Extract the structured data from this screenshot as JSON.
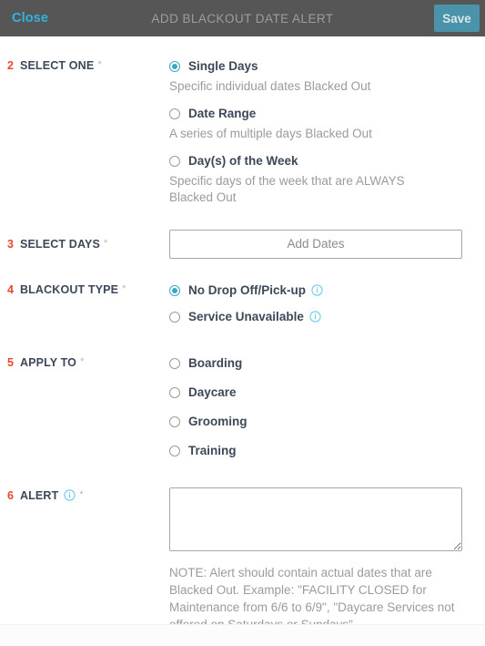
{
  "header": {
    "close_label": "Close",
    "title": "ADD BLACKOUT DATE ALERT",
    "save_label": "Save",
    "bar_color": "#565656",
    "close_color": "#32b3e0",
    "save_color": "#4a93a8"
  },
  "theme": {
    "number_color": "#e8472c",
    "accent_color": "#3aa8c1",
    "label_color": "#3c4858",
    "muted_color": "#9b9b9b"
  },
  "sections": {
    "select_one": {
      "number": "2",
      "title": "SELECT ONE",
      "required_mark": "*",
      "options": [
        {
          "label": "Single Days",
          "description": "Specific individual dates Blacked Out",
          "selected": true
        },
        {
          "label": "Date Range",
          "description": "A series of multiple days Blacked Out",
          "selected": false
        },
        {
          "label": "Day(s) of the Week",
          "description": "Specific days of the week that are ALWAYS Blacked Out",
          "selected": false
        }
      ]
    },
    "select_days": {
      "number": "3",
      "title": "SELECT DAYS",
      "required_mark": "*",
      "button_label": "Add Dates"
    },
    "blackout_type": {
      "number": "4",
      "title": "BLACKOUT TYPE",
      "required_mark": "*",
      "options": [
        {
          "label": "No Drop Off/Pick-up",
          "selected": true,
          "info_icon": "info-icon"
        },
        {
          "label": "Service Unavailable",
          "selected": false,
          "info_icon": "info-icon"
        }
      ]
    },
    "apply_to": {
      "number": "5",
      "title": "APPLY TO",
      "required_mark": "*",
      "options": [
        {
          "label": "Boarding",
          "selected": false
        },
        {
          "label": "Daycare",
          "selected": false
        },
        {
          "label": "Grooming",
          "selected": false
        },
        {
          "label": "Training",
          "selected": false
        }
      ]
    },
    "alert": {
      "number": "6",
      "title": "ALERT",
      "required_mark": "*",
      "info_icon": "info-icon",
      "textarea_value": "",
      "textarea_placeholder": "",
      "note": "NOTE: Alert should contain actual dates that are Blacked Out. Example: \"FACILITY CLOSED for Maintenance from 6/6 to 6/9\", \"Daycare Services not offered on Saturdays or Sundays\""
    }
  }
}
